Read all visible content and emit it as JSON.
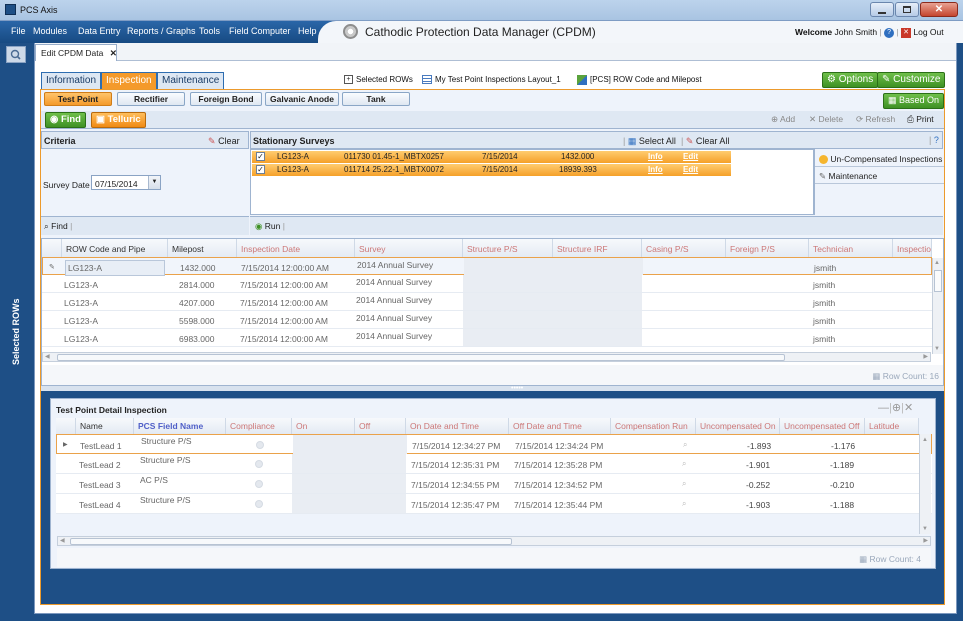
{
  "window": {
    "title": "PCS Axis"
  },
  "menu": [
    "File",
    "Modules",
    "Data Entry",
    "Reports / Graphs",
    "Tools",
    "Field Computer",
    "Help"
  ],
  "app_title": "Cathodic Protection Data Manager (CPDM)",
  "user": {
    "welcome_label": "Welcome",
    "name": "John Smith",
    "logout": "Log Out"
  },
  "sidebar": {
    "label": "Selected ROWs"
  },
  "doc_tab": {
    "label": "Edit CPDM Data",
    "close": "✕"
  },
  "top_tabs": [
    "Information",
    "Inspection",
    "Maintenance"
  ],
  "layout_links": [
    "Selected ROWs",
    "My Test Point Inspections Layout_1",
    "[PCS] ROW Code and Milepost"
  ],
  "options_btn": "Options",
  "customize_btn": "Customize",
  "sub_tabs": [
    "Test Point",
    "Rectifier",
    "Foreign Bond",
    "Galvanic Anode",
    "Tank"
  ],
  "based_on_btn": "Based On",
  "find_btn": "Find",
  "telluric_btn": "Telluric",
  "toolbar": {
    "add": "Add",
    "delete": "Delete",
    "refresh": "Refresh",
    "print": "Print"
  },
  "criteria": {
    "title": "Criteria",
    "clear": "Clear",
    "survey_date_label": "Survey Date",
    "survey_date": "07/15/2014",
    "find": "Find"
  },
  "stationary": {
    "title": "Stationary Surveys",
    "select_all": "Select All",
    "clear_all": "Clear All",
    "run": "Run",
    "rows": [
      {
        "checked": "✓",
        "row": "LG123-A",
        "tp": "011730 01.45-1_MBTX0257",
        "date": "7/15/2014",
        "mp": "1432.000",
        "info": "Info",
        "edit": "Edit"
      },
      {
        "checked": "✓",
        "row": "LG123-A",
        "tp": "011714 25.22-1_MBTX0072",
        "date": "7/15/2014",
        "mp": "18939.393",
        "info": "Info",
        "edit": "Edit"
      }
    ]
  },
  "side_panel": [
    "Un-Compensated Inspections",
    "Maintenance"
  ],
  "grid": {
    "headers": [
      "ROW Code and Pipe",
      "Milepost",
      "Inspection Date",
      "Survey",
      "Structure P/S",
      "Structure IRF",
      "Casing P/S",
      "Foreign P/S",
      "Technician",
      "Inspectio"
    ],
    "rows": [
      {
        "row": "LG123-A",
        "mp": "1432.000",
        "date": "7/15/2014 12:00:00 AM",
        "survey": "2014 Annual Survey",
        "tech": "jsmith"
      },
      {
        "row": "LG123-A",
        "mp": "2814.000",
        "date": "7/15/2014 12:00:00 AM",
        "survey": "2014 Annual Survey",
        "tech": "jsmith"
      },
      {
        "row": "LG123-A",
        "mp": "4207.000",
        "date": "7/15/2014 12:00:00 AM",
        "survey": "2014 Annual Survey",
        "tech": "jsmith"
      },
      {
        "row": "LG123-A",
        "mp": "5598.000",
        "date": "7/15/2014 12:00:00 AM",
        "survey": "2014 Annual Survey",
        "tech": "jsmith"
      },
      {
        "row": "LG123-A",
        "mp": "6983.000",
        "date": "7/15/2014 12:00:00 AM",
        "survey": "2014 Annual Survey",
        "tech": "jsmith"
      }
    ],
    "row_count": "Row Count: 16"
  },
  "detail": {
    "title": "Test Point Detail Inspection",
    "headers": [
      "Name",
      "PCS Field Name",
      "Compliance",
      "On",
      "Off",
      "On Date and Time",
      "Off Date and Time",
      "Compensation Run",
      "Uncompensated On",
      "Uncompensated Off",
      "Latitude"
    ],
    "rows": [
      {
        "name": "TestLead 1",
        "field": "Structure P/S",
        "on_dt": "7/15/2014 12:34:27 PM",
        "off_dt": "7/15/2014 12:34:24 PM",
        "u_on": "-1.893",
        "u_off": "-1.176"
      },
      {
        "name": "TestLead 2",
        "field": "Structure P/S",
        "on_dt": "7/15/2014 12:35:31 PM",
        "off_dt": "7/15/2014 12:35:28 PM",
        "u_on": "-1.901",
        "u_off": "-1.189"
      },
      {
        "name": "TestLead 3",
        "field": "AC P/S",
        "on_dt": "7/15/2014 12:34:55 PM",
        "off_dt": "7/15/2014 12:34:52 PM",
        "u_on": "-0.252",
        "u_off": "-0.210"
      },
      {
        "name": "TestLead 4",
        "field": "Structure P/S",
        "on_dt": "7/15/2014 12:35:47 PM",
        "off_dt": "7/15/2014 12:35:44 PM",
        "u_on": "-1.903",
        "u_off": "-1.188"
      }
    ],
    "row_count": "Row Count: 4"
  },
  "colors": {
    "accent_orange": "#f49a2b",
    "green": "#4aa52c",
    "blue": "#1e4f86"
  }
}
